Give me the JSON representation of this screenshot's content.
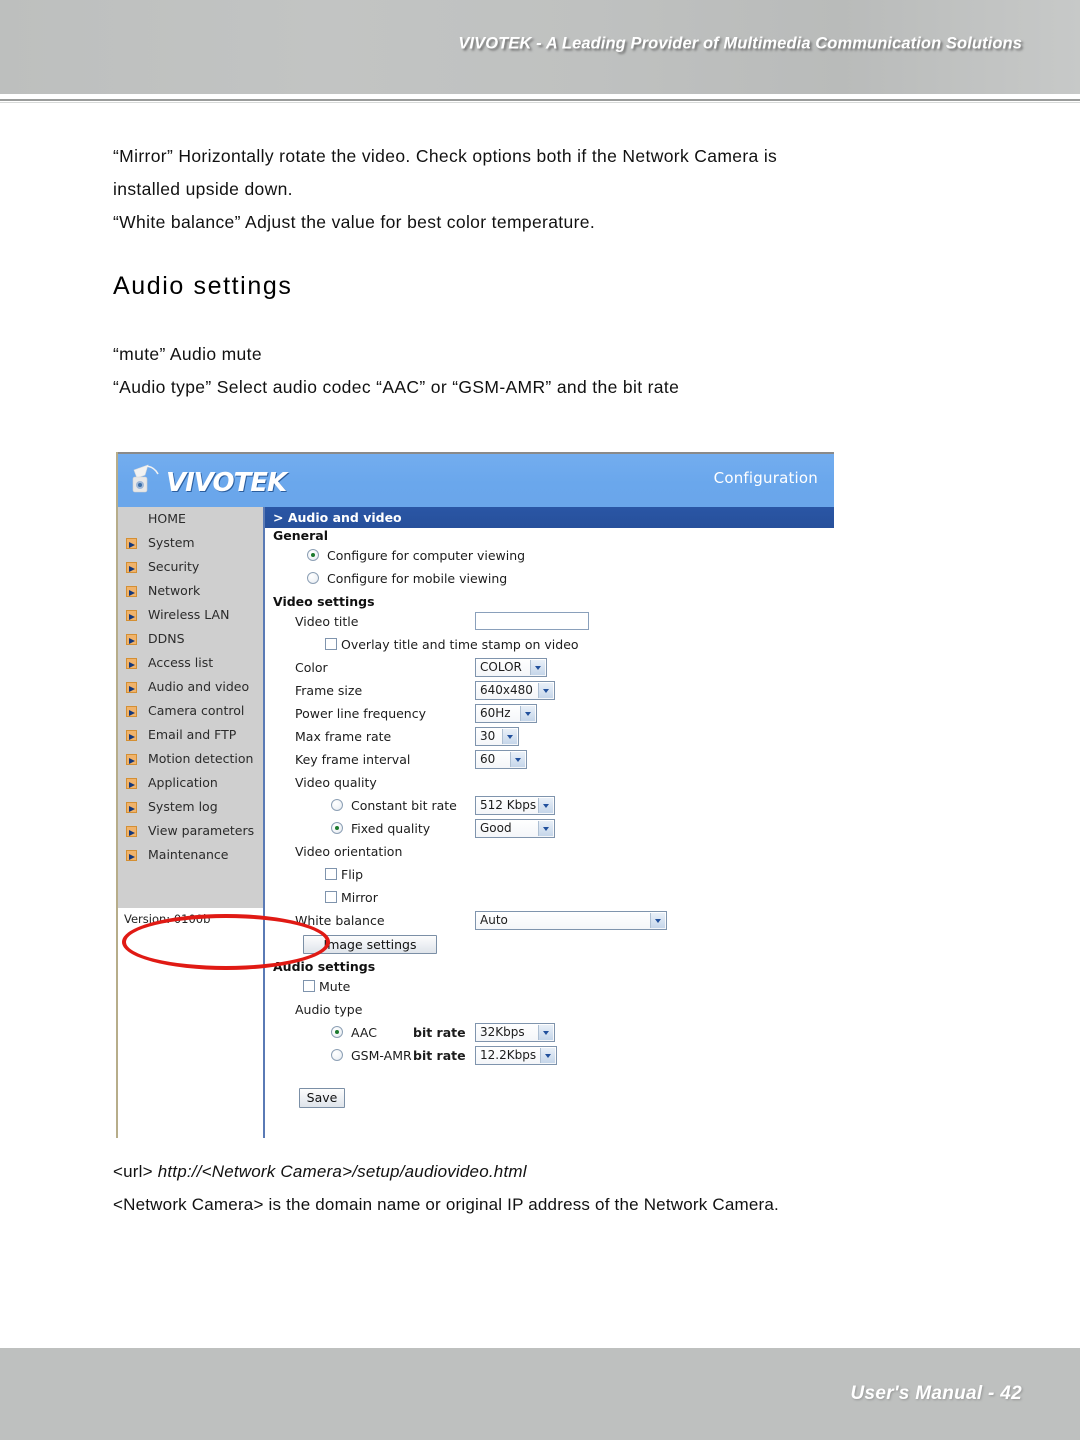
{
  "banner": {
    "tagline": "VIVOTEK - A Leading Provider of Multimedia Communication Solutions"
  },
  "body": {
    "para1_line1": "“Mirror” Horizontally rotate the video. Check options both if the Network Camera is",
    "para1_line2": "installed upside down.",
    "para2": "“White balance” Adjust the value for best color temperature."
  },
  "section": {
    "title": "Audio settings",
    "line1": "“mute” Audio mute",
    "line2": "“Audio type” Select audio codec “AAC” or “GSM-AMR” and the bit rate"
  },
  "screenshot": {
    "brand": "VIVOTEK",
    "config_label": "Configuration",
    "breadcrumb": "> Audio and video",
    "version": "Version: 0100b",
    "nav": [
      {
        "label": "HOME",
        "has_arrow": false
      },
      {
        "label": "System",
        "has_arrow": true
      },
      {
        "label": "Security",
        "has_arrow": true
      },
      {
        "label": "Network",
        "has_arrow": true
      },
      {
        "label": "Wireless LAN",
        "has_arrow": true
      },
      {
        "label": "DDNS",
        "has_arrow": true
      },
      {
        "label": "Access list",
        "has_arrow": true
      },
      {
        "label": "Audio and video",
        "has_arrow": true
      },
      {
        "label": "Camera control",
        "has_arrow": true
      },
      {
        "label": "Email and FTP",
        "has_arrow": true
      },
      {
        "label": "Motion detection",
        "has_arrow": true
      },
      {
        "label": "Application",
        "has_arrow": true
      },
      {
        "label": "System log",
        "has_arrow": true
      },
      {
        "label": "View parameters",
        "has_arrow": true
      },
      {
        "label": "Maintenance",
        "has_arrow": true
      }
    ],
    "general": {
      "heading": "General",
      "opt_computer": "Configure for computer viewing",
      "opt_mobile": "Configure for mobile viewing",
      "selected": "computer"
    },
    "video_settings": {
      "heading": "Video settings",
      "video_title_label": "Video title",
      "video_title_value": "",
      "overlay_label": "Overlay title and time stamp on video",
      "overlay_checked": false,
      "color_label": "Color",
      "color_value": "COLOR",
      "frame_size_label": "Frame size",
      "frame_size_value": "640x480",
      "power_freq_label": "Power line frequency",
      "power_freq_value": "60Hz",
      "max_frame_rate_label": "Max frame rate",
      "max_frame_rate_value": "30",
      "key_frame_label": "Key frame interval",
      "key_frame_value": "60",
      "video_quality_label": "Video quality",
      "constant_bit_rate_label": "Constant bit rate",
      "constant_bit_rate_value": "512 Kbps",
      "fixed_quality_label": "Fixed quality",
      "fixed_quality_value": "Good",
      "quality_selected": "fixed",
      "video_orientation_label": "Video orientation",
      "flip_label": "Flip",
      "flip_checked": false,
      "mirror_label": "Mirror",
      "mirror_checked": false,
      "white_balance_label": "White balance",
      "white_balance_value": "Auto",
      "image_settings_button": "Image settings"
    },
    "audio_settings": {
      "heading": "Audio settings",
      "mute_label": "Mute",
      "mute_checked": false,
      "audio_type_label": "Audio type",
      "aac_label": "AAC",
      "aac_bitrate_label": "bit rate",
      "aac_bitrate_value": "32Kbps",
      "gsm_label": "GSM-AMR",
      "gsm_bitrate_label": "bit rate",
      "gsm_bitrate_value": "12.2Kbps",
      "selected": "aac"
    },
    "save_button": "Save",
    "annotation_color": "#e01a14"
  },
  "caption": {
    "url_prefix": "<url>",
    "url_value": "http://<Network Camera>/setup/audiovideo.html",
    "note": "<Network Camera> is the domain name or original IP address of the Network Camera."
  },
  "footer": {
    "note": "User's Manual - 42"
  }
}
